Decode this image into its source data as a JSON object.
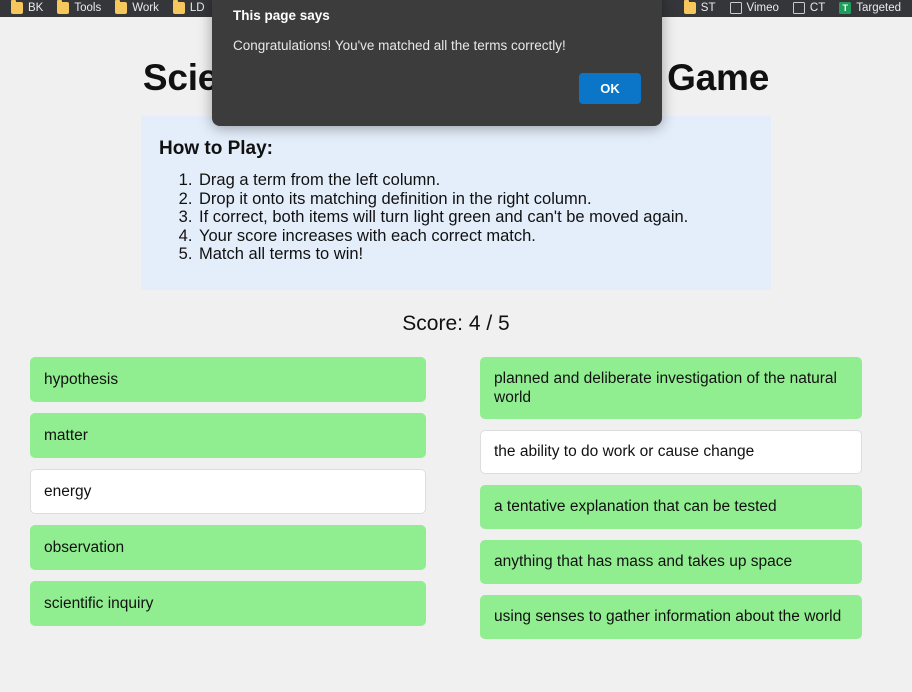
{
  "browser": {
    "bookmarks": [
      {
        "label": "BK",
        "icon": "folder-icon"
      },
      {
        "label": "Tools",
        "icon": "folder-icon"
      },
      {
        "label": "Work",
        "icon": "folder-icon"
      },
      {
        "label": "LD",
        "icon": "folder-icon"
      },
      {
        "label": "ST",
        "icon": "folder-icon"
      },
      {
        "label": "Vimeo",
        "icon": "page-icon"
      },
      {
        "label": "CT",
        "icon": "page-icon"
      },
      {
        "label": "Targeted",
        "icon": "sheets-icon",
        "glyph": "T"
      }
    ]
  },
  "dialog": {
    "title": "This page says",
    "message": "Congratulations! You've matched all the terms correctly!",
    "ok_label": "OK"
  },
  "page": {
    "title": "Science Vocabulary Matching Game",
    "howto": {
      "heading": "How to Play:",
      "steps": [
        "Drag a term from the left column.",
        "Drop it onto its matching definition in the right column.",
        "If correct, both items will turn light green and can't be moved again.",
        "Your score increases with each correct match.",
        "Match all terms to win!"
      ]
    },
    "score_label": "Score: 4 / 5",
    "score": 4,
    "score_total": 5
  },
  "colors": {
    "matched_green": "#90ee90",
    "unmatched_white": "#ffffff",
    "panel_blue": "#e4eefb",
    "page_bg": "#f0f0f0",
    "dialog_bg": "#3c3c3c",
    "ok_blue": "#0b76c8"
  },
  "terms": [
    {
      "text": "hypothesis",
      "matched": true
    },
    {
      "text": "matter",
      "matched": true
    },
    {
      "text": "energy",
      "matched": false
    },
    {
      "text": "observation",
      "matched": true
    },
    {
      "text": "scientific inquiry",
      "matched": true
    }
  ],
  "definitions": [
    {
      "text": "planned and deliberate investigation of the natural world",
      "matched": true
    },
    {
      "text": "the ability to do work or cause change",
      "matched": false
    },
    {
      "text": "a tentative explanation that can be tested",
      "matched": true
    },
    {
      "text": "anything that has mass and takes up space",
      "matched": true
    },
    {
      "text": "using senses to gather information about the world",
      "matched": true
    }
  ]
}
